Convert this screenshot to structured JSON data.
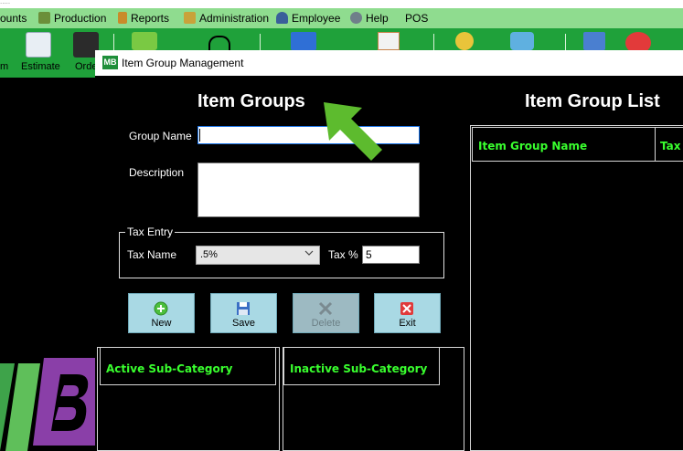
{
  "menu": {
    "items": [
      {
        "label": "ounts"
      },
      {
        "label": "Production",
        "color": "#6b8f3a"
      },
      {
        "label": "Reports",
        "color": "#c98b2a"
      },
      {
        "label": "Administration",
        "color": "#c9a23a"
      },
      {
        "label": "Employee",
        "color": "#3a5f9a"
      },
      {
        "label": "Help",
        "color": "#6f7f8a"
      },
      {
        "label": "POS"
      }
    ]
  },
  "toolbar": {
    "items": [
      {
        "label": "m"
      },
      {
        "label": "Estimate"
      },
      {
        "label": "Orde"
      }
    ]
  },
  "dialog": {
    "title": "Item Group Management",
    "logo_text": "MB",
    "left_heading": "Item Groups",
    "right_heading": "Item Group List",
    "group_name_label": "Group Name",
    "group_name_value": "",
    "description_label": "Description",
    "description_value": "",
    "tax_entry_legend": "Tax Entry",
    "tax_name_label": "Tax Name",
    "tax_name_selected": ".5%",
    "tax_pct_label": "Tax %",
    "tax_pct_value": "5",
    "buttons": {
      "new": "New",
      "save": "Save",
      "delete": "Delete",
      "exit": "Exit"
    },
    "active_subcat_header": "Active Sub-Category",
    "inactive_subcat_header": "Inactive Sub-Category",
    "list_columns": [
      "Item Group Name",
      "Tax I"
    ]
  },
  "colors": {
    "menubar": "#8fdc8f",
    "toolbar": "#1fa13a",
    "grid_header_text": "#39ff2e",
    "button_bg": "#a9d9e4",
    "cursor_arrow": "#5dbb2e"
  }
}
